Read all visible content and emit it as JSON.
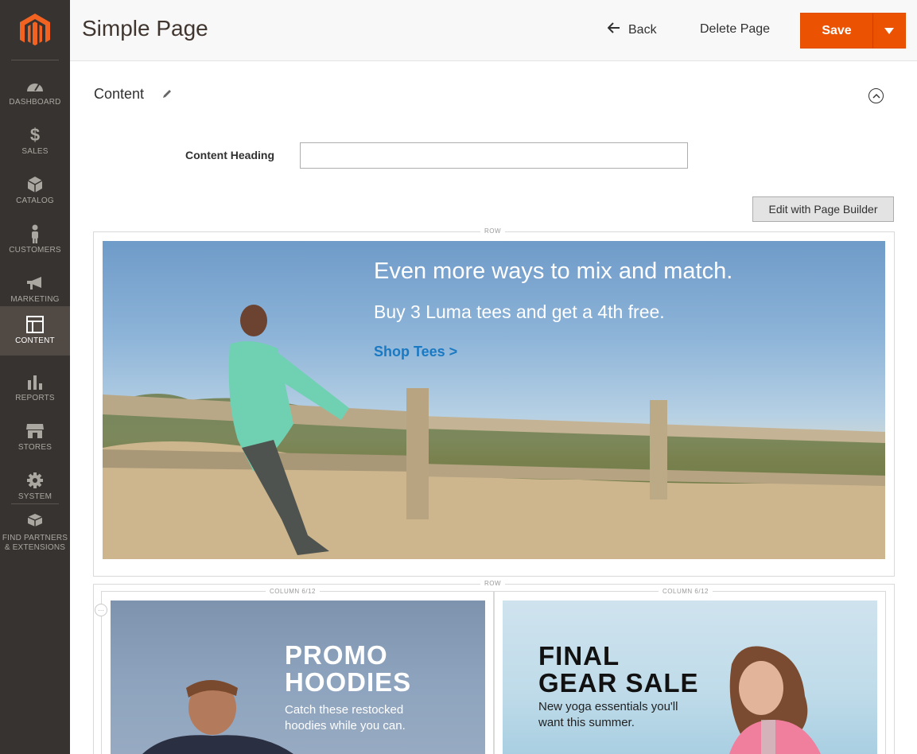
{
  "sidebar": {
    "logo": "magento-logo",
    "items": [
      {
        "label": "DASHBOARD",
        "icon": "dashboard-icon"
      },
      {
        "label": "SALES",
        "icon": "dollar-icon"
      },
      {
        "label": "CATALOG",
        "icon": "cube-icon"
      },
      {
        "label": "CUSTOMERS",
        "icon": "person-icon"
      },
      {
        "label": "MARKETING",
        "icon": "megaphone-icon"
      },
      {
        "label": "CONTENT",
        "icon": "layout-icon",
        "active": true
      },
      {
        "label": "REPORTS",
        "icon": "bar-chart-icon"
      },
      {
        "label": "STORES",
        "icon": "storefront-icon"
      },
      {
        "label": "SYSTEM",
        "icon": "gear-icon"
      },
      {
        "label_line1": "FIND PARTNERS",
        "label_line2": "& EXTENSIONS",
        "icon": "boxes-icon"
      }
    ]
  },
  "header": {
    "title": "Simple Page",
    "back_label": "Back",
    "delete_label": "Delete Page",
    "save_label": "Save"
  },
  "content": {
    "section_title": "Content",
    "heading_label": "Content Heading",
    "heading_value": "",
    "page_builder_button": "Edit with Page Builder"
  },
  "page_builder": {
    "row_label": "ROW",
    "banner": {
      "headline": "Even more ways to mix and match.",
      "subheadline": "Buy 3 Luma tees and get a 4th free.",
      "link": "Shop Tees >"
    },
    "columns": [
      {
        "label": "COLUMN 6/12",
        "title_line1": "PROMO",
        "title_line2": "HOODIES",
        "sub_line1": "Catch these restocked",
        "sub_line2": "hoodies while you can."
      },
      {
        "label": "COLUMN 6/12",
        "title_line1": "FINAL",
        "title_line2": "GEAR SALE",
        "sub_line1": "New yoga essentials you'll",
        "sub_line2": "want this summer."
      }
    ]
  },
  "colors": {
    "sidebar_bg": "#373330",
    "sidebar_active": "#514943",
    "brand_orange": "#eb5202",
    "link_blue": "#1979c3"
  }
}
